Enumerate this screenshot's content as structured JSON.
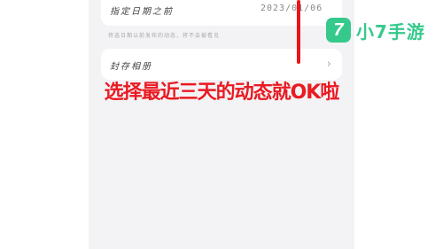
{
  "settings": {
    "specified_date_label": "指定日期之前",
    "specified_date_value": "2023/01/06",
    "hint_text": "将选日期以前发布的动态，将不会被看见",
    "archive_album_label": "封存相册",
    "chevron": "›"
  },
  "caption": "选择最近三天的动态就OK啦",
  "watermark": {
    "logo_glyph": "7",
    "name": "小7手游"
  },
  "colors": {
    "accent_red": "#e8151b",
    "brand_green": "#36c98c"
  }
}
